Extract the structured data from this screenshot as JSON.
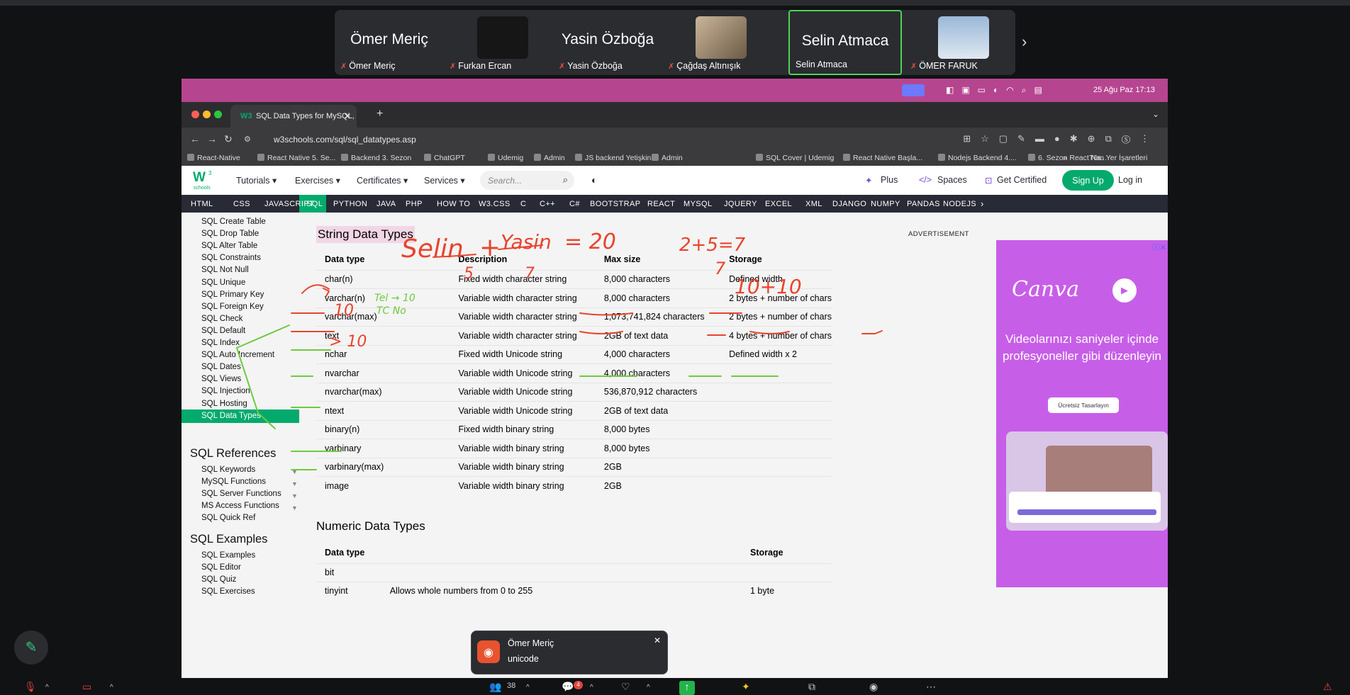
{
  "participants": {
    "tiles": [
      {
        "big": "Ömer Meriç",
        "label": "Ömer Meriç"
      },
      {
        "big": "",
        "label": "Furkan Ercan"
      },
      {
        "big": "Yasin Özboğa",
        "label": "Yasin Özboğa"
      },
      {
        "big": "",
        "label": "Çağdaş Altınışık"
      },
      {
        "big": "Selin Atmaca",
        "label": "Selin Atmaca"
      },
      {
        "big": "",
        "label": "ÖMER FARUK"
      }
    ],
    "next_icon": "chevron-right"
  },
  "mac": {
    "clock": "25 Ağu Paz  17:13"
  },
  "browser": {
    "tab_title": "SQL Data Types for MySQL, S",
    "url": "w3schools.com/sql/sql_datatypes.asp",
    "bookmarks": [
      "React-Native",
      "React Native 5. Se...",
      "Backend 3. Sezon",
      "ChatGPT",
      "Udemig",
      "Admin",
      "JS backend Yetişkin",
      "Admin",
      "SQL Cover | Udemig",
      "React Native Başla...",
      "Nodejs Backend 4....",
      "6. Sezon React Na..."
    ],
    "bookmarks_more": "»",
    "all_bookmarks": "Tüm Yer İşaretleri"
  },
  "w3": {
    "logo_top": "3",
    "logo_bottom": "schools",
    "menu": [
      "Tutorials ▾",
      "Exercises ▾",
      "Certificates ▾",
      "Services ▾"
    ],
    "search_placeholder": "Search...",
    "plus": "Plus",
    "spaces": "Spaces",
    "get_certified": "Get Certified",
    "signup": "Sign Up",
    "login": "Log in",
    "topnav": [
      "HTML",
      "CSS",
      "JAVASCRIPT",
      "SQL",
      "PYTHON",
      "JAVA",
      "PHP",
      "HOW TO",
      "W3.CSS",
      "C",
      "C++",
      "C#",
      "BOOTSTRAP",
      "REACT",
      "MYSQL",
      "JQUERY",
      "EXCEL",
      "XML",
      "DJANGO",
      "NUMPY",
      "PANDAS",
      "NODEJS"
    ]
  },
  "sidebar": {
    "items": [
      "SQL Create Table",
      "SQL Drop Table",
      "SQL Alter Table",
      "SQL Constraints",
      "SQL Not Null",
      "SQL Unique",
      "SQL Primary Key",
      "SQL Foreign Key",
      "SQL Check",
      "SQL Default",
      "SQL Index",
      "SQL Auto Increment",
      "SQL Dates",
      "SQL Views",
      "SQL Injection",
      "SQL Hosting",
      "SQL Data Types"
    ],
    "references_title": "SQL References",
    "references": [
      "SQL Keywords",
      "MySQL Functions",
      "SQL Server Functions",
      "MS Access Functions",
      "SQL Quick Ref"
    ],
    "examples_title": "SQL Examples",
    "examples": [
      "SQL Examples",
      "SQL Editor",
      "SQL Quiz",
      "SQL Exercises"
    ]
  },
  "main": {
    "section_title": "String Data Types",
    "headers": [
      "Data type",
      "Description",
      "Max size",
      "Storage"
    ],
    "rows": [
      [
        "char(n)",
        "Fixed width character string",
        "8,000 characters",
        "Defined width"
      ],
      [
        "varchar(n)",
        "Variable width character string",
        "8,000 characters",
        "2 bytes + number of chars"
      ],
      [
        "varchar(max)",
        "Variable width character string",
        "1,073,741,824 characters",
        "2 bytes + number of chars"
      ],
      [
        "text",
        "Variable width character string",
        "2GB of text data",
        "4 bytes + number of chars"
      ],
      [
        "nchar",
        "Fixed width Unicode string",
        "4,000 characters",
        "Defined width x 2"
      ],
      [
        "nvarchar",
        "Variable width Unicode string",
        "4,000 characters",
        ""
      ],
      [
        "nvarchar(max)",
        "Variable width Unicode string",
        "536,870,912 characters",
        ""
      ],
      [
        "ntext",
        "Variable width Unicode string",
        "2GB of text data",
        ""
      ],
      [
        "binary(n)",
        "Fixed width binary string",
        "8,000 bytes",
        ""
      ],
      [
        "varbinary",
        "Variable width binary string",
        "8,000 bytes",
        ""
      ],
      [
        "varbinary(max)",
        "Variable width binary string",
        "2GB",
        ""
      ],
      [
        "image",
        "Variable width binary string",
        "2GB",
        ""
      ]
    ],
    "numeric_title": "Numeric Data Types",
    "numeric_headers": [
      "Data type",
      "Storage"
    ],
    "numeric_rows": [
      [
        "bit",
        ""
      ],
      [
        "tinyint",
        "1 byte"
      ]
    ],
    "tinyint_partial": "Allows whole numbers from 0 to 255"
  },
  "ad": {
    "label": "ADVERTISEMENT",
    "brand": "Canva",
    "text": "Videolarınızı saniyeler içinde profesyoneller gibi düzenleyin",
    "button": "Ücretsiz Tasarlayın"
  },
  "annotations": {
    "selin": "Selin",
    "plus": "+",
    "yasin": "Yasin",
    "eq20": "= 20",
    "five": "5",
    "seven_a": "7",
    "sum": "2+5=7",
    "seven_b": "7",
    "tenplus": "10+10",
    "ten": "10",
    "tc": "Tel → 10\nTC No",
    "gt10": "> 10"
  },
  "toast": {
    "name": "Ömer Meriç",
    "message": "unicode"
  },
  "controls": {
    "participant_count": "38",
    "chat_badge": "4"
  },
  "colors": {
    "w3green": "#04aa6d",
    "macbar": "#b64590",
    "ink_red": "#e8442e",
    "ink_green": "#6ccb3e",
    "active_speaker": "#4fd157"
  }
}
